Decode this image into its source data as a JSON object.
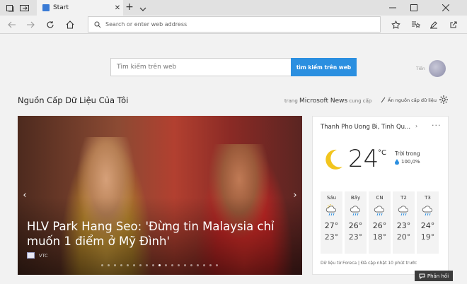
{
  "browser": {
    "tab_title": "Start",
    "new_tab_symbol": "+",
    "address_placeholder": "Search or enter web address"
  },
  "search": {
    "placeholder": "Tìm kiếm trên web",
    "button_label": "tìm kiếm trên web"
  },
  "user": {
    "name": "Tiến"
  },
  "feed": {
    "title": "Nguồn Cấp Dữ Liệu Của Tôi",
    "provider_prefix": "trang",
    "provider_name": "Microsoft News",
    "provider_suffix": "cung cấp",
    "hide_label": "Ẩn nguồn cấp dữ liệu"
  },
  "hero": {
    "headline": "HLV Park Hang Seo: 'Đừng tin Malaysia chỉ muốn 1 điểm ở Mỹ Đình'",
    "source": "VTC",
    "slide_count": 19,
    "active_slide": 9
  },
  "weather": {
    "location": "Thanh Pho Uong Bi, Tinh Qu...",
    "current_temp": "24",
    "unit": "°C",
    "condition": "Trời trong",
    "rain_chance": "100,0%",
    "forecast": [
      {
        "day": "Sáu",
        "icon": "partly-sunny-rain-icon",
        "hi": "27°",
        "lo": "23°"
      },
      {
        "day": "Bảy",
        "icon": "rain-cloud-icon",
        "hi": "26°",
        "lo": "23°"
      },
      {
        "day": "CN",
        "icon": "rain-cloud-icon",
        "hi": "26°",
        "lo": "18°"
      },
      {
        "day": "T2",
        "icon": "rain-cloud-icon",
        "hi": "23°",
        "lo": "20°"
      },
      {
        "day": "T3",
        "icon": "rain-cloud-icon",
        "hi": "24°",
        "lo": "19°"
      }
    ],
    "footer": "Dữ liệu từ Foreca | Đã cập nhật 10 phút trước"
  },
  "feedback": {
    "label": "Phản hồi"
  },
  "colors": {
    "accent": "#2b8fe0",
    "tabbar": "#e1e1e1",
    "content_bg": "#f2f2f2"
  }
}
